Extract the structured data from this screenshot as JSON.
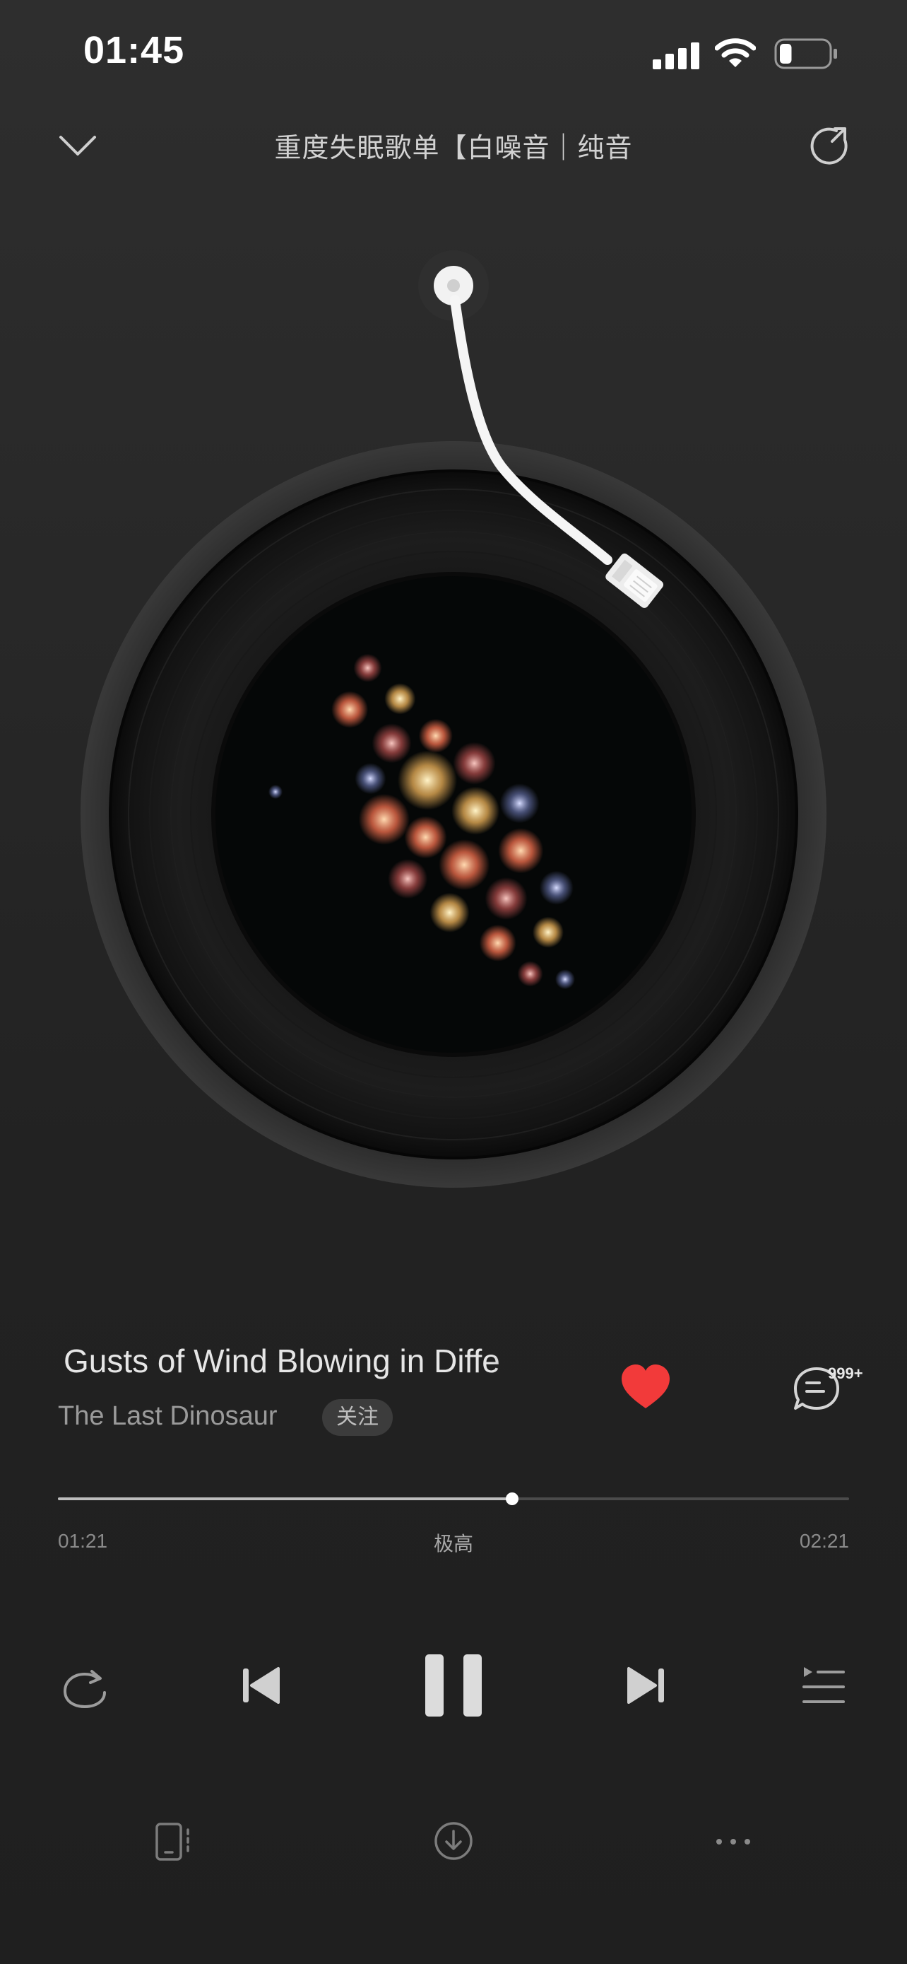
{
  "status_bar": {
    "time": "01:45",
    "battery_level": 0.25
  },
  "header": {
    "playlist_title": "重度失眠歌单【白噪音｜纯音"
  },
  "song": {
    "title": "Gusts of Wind Blowing in Diffe",
    "artist": "The Last Dinosaur",
    "follow_label": "关注",
    "liked": true,
    "comment_count": "999+"
  },
  "progress": {
    "current": "01:21",
    "total": "02:21",
    "quality": "极高",
    "fraction": 0.574
  },
  "colors": {
    "accent_like": "#f23a3a",
    "background": "#262626"
  },
  "icons": {
    "header": [
      "chevron-down-icon",
      "share-icon"
    ],
    "controls": [
      "repeat-icon",
      "previous-icon",
      "pause-icon",
      "next-icon",
      "playlist-icon"
    ],
    "bottom": [
      "device-icon",
      "download-icon",
      "more-icon"
    ]
  }
}
